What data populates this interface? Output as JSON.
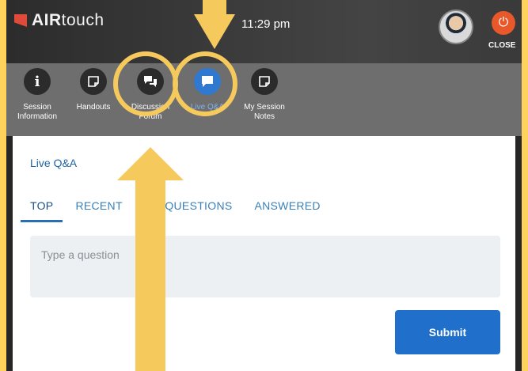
{
  "app": {
    "brand_bold": "AIR",
    "brand_light": "touch",
    "time": "11:29 pm",
    "close_label": "CLOSE"
  },
  "tabs": [
    {
      "label": "Session Information",
      "icon": "info-icon",
      "active": false
    },
    {
      "label": "Handouts",
      "icon": "handout-icon",
      "active": false
    },
    {
      "label": "Discussion Forum",
      "icon": "chat-bubbles-icon",
      "active": false
    },
    {
      "label": "Live Q&A",
      "icon": "speech-bubble-icon",
      "active": true
    },
    {
      "label": "My Session Notes",
      "icon": "notes-icon",
      "active": false
    }
  ],
  "qa": {
    "title": "Live Q&A",
    "tabs": [
      {
        "label": "TOP",
        "active": true
      },
      {
        "label": "RECENT",
        "active": false
      },
      {
        "label": "MY QUESTIONS",
        "active": false
      },
      {
        "label": "ANSWERED",
        "active": false
      }
    ],
    "input_placeholder": "Type a question",
    "submit_label": "Submit"
  },
  "colors": {
    "annotation_yellow": "#f5c95b",
    "accent_blue": "#1f6fcb",
    "close_orange": "#e8582a"
  }
}
